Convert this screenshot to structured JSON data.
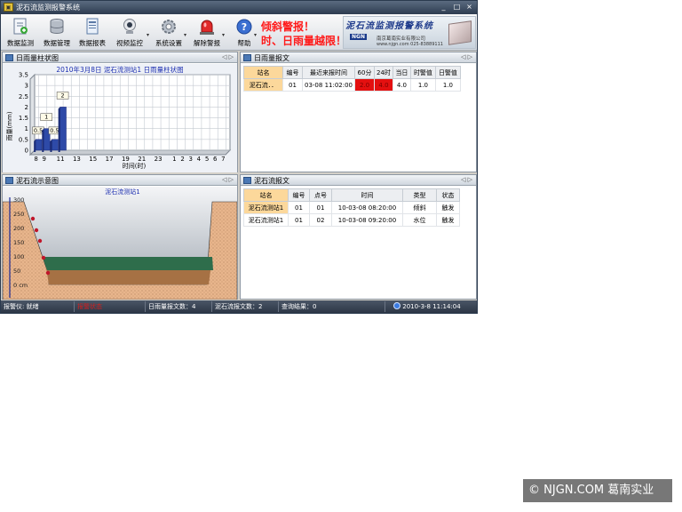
{
  "window": {
    "title": "泥石流监测报警系统",
    "app_icon": "monitor-app-icon"
  },
  "toolbar": {
    "buttons": [
      {
        "label": "数据监测",
        "icon": "data-monitor-icon"
      },
      {
        "label": "数据管理",
        "icon": "database-icon"
      },
      {
        "label": "数据报表",
        "icon": "report-icon"
      },
      {
        "label": "视频监控",
        "icon": "webcam-icon"
      },
      {
        "label": "系统设置",
        "icon": "gear-icon"
      },
      {
        "label": "解除警报",
        "icon": "alarm-light-icon"
      },
      {
        "label": "帮助",
        "icon": "help-icon"
      }
    ],
    "alarm_line1": "倾斜警报！",
    "alarm_line2": "时、日雨量越限！",
    "alarm_color": "#ff1a1a"
  },
  "brand": {
    "title": "泥石流监测报警系统",
    "logo": "NGN",
    "company": "南京葛南实业有限公司",
    "website": "www.njgn.com  025-83889111"
  },
  "rain_chart_panel": {
    "title": "日雨量柱状图",
    "nav": "◁ ▷",
    "chart_data": {
      "type": "bar",
      "title": "2010年3月8日 泥石流测站1 日雨量柱状图",
      "xlabel": "时间(时)",
      "ylabel": "雨量(mm)",
      "ylim": [
        0,
        3.5
      ],
      "yticks": [
        "3.5",
        "3",
        "2.5",
        "2",
        "1.5",
        "1",
        "0.5",
        "0"
      ],
      "xticks": [
        "8",
        "9",
        "11",
        "13",
        "15",
        "17",
        "19",
        "21",
        "23",
        "1",
        "2",
        "3",
        "4",
        "5",
        "6",
        "7"
      ],
      "x": [
        8,
        9,
        10,
        11
      ],
      "values": [
        0.5,
        1,
        0.5,
        2
      ],
      "data_labels": [
        "0.5",
        "1",
        "0.5",
        "2"
      ],
      "bar_color": "#2e4aa8",
      "grid": true
    }
  },
  "rain_report": {
    "title": "日雨量报文",
    "nav": "◁ ▷",
    "columns": [
      "站名",
      "编号",
      "最近来报时间",
      "60分",
      "24时",
      "当日",
      "时警值",
      "日警值"
    ],
    "rows": [
      [
        "泥石流．．",
        "01",
        "03-08 11:02:00",
        "2.0",
        "4.0",
        "4.0",
        "1.0",
        "1.0"
      ]
    ],
    "alert_color": "#e41010"
  },
  "diagram_panel": {
    "title": "泥石流示意图",
    "nav": "◁ ▷",
    "station": "泥石流测站1",
    "scale_ticks": [
      "300",
      "250",
      "200",
      "150",
      "100",
      "50",
      "0 cm"
    ]
  },
  "debris_report": {
    "title": "泥石流报文",
    "nav": "◁ ▷",
    "columns": [
      "站名",
      "编号",
      "点号",
      "时间",
      "类型",
      "状态"
    ],
    "rows": [
      [
        "泥石流测站1",
        "01",
        "01",
        "10-03-08 08:20:00",
        "倾斜",
        "触发"
      ],
      [
        "泥石流测站1",
        "01",
        "02",
        "10-03-08 09:20:00",
        "水位",
        "触发"
      ]
    ]
  },
  "status": {
    "alarm_device": "报警仪: 就绪",
    "alarm_state": "报警状态",
    "rain_count": "日雨量报文数：4",
    "debris_count": "泥石流报文数：2",
    "query_result": "查询结果：0",
    "clock": "2010-3-8  11:14:04"
  },
  "watermark": "© NJGN.COM 葛南实业"
}
